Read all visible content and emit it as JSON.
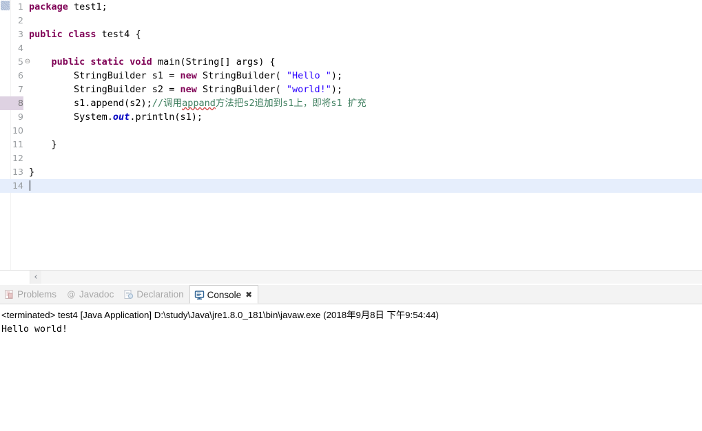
{
  "editor": {
    "annotation_ruler_marker": "changed-lines-marker",
    "current_line": 14,
    "marked_line": 8,
    "fold_line": 5,
    "fold_glyph": "⊖",
    "caret_glyph": "",
    "lines": [
      {
        "number": "1",
        "tokens": [
          {
            "t": "kw",
            "v": "package"
          },
          {
            "t": "plain",
            "v": " test1;"
          }
        ]
      },
      {
        "number": "2",
        "tokens": []
      },
      {
        "number": "3",
        "tokens": [
          {
            "t": "kw",
            "v": "public class"
          },
          {
            "t": "plain",
            "v": " test4 {"
          }
        ]
      },
      {
        "number": "4",
        "tokens": []
      },
      {
        "number": "5",
        "tokens": [
          {
            "t": "plain",
            "v": "    "
          },
          {
            "t": "kw",
            "v": "public static void"
          },
          {
            "t": "plain",
            "v": " main(String[] args) {"
          }
        ]
      },
      {
        "number": "6",
        "tokens": [
          {
            "t": "plain",
            "v": "        StringBuilder s1 = "
          },
          {
            "t": "kw",
            "v": "new"
          },
          {
            "t": "plain",
            "v": " StringBuilder( "
          },
          {
            "t": "str",
            "v": "\"Hello \""
          },
          {
            "t": "plain",
            "v": ");"
          }
        ]
      },
      {
        "number": "7",
        "tokens": [
          {
            "t": "plain",
            "v": "        StringBuilder s2 = "
          },
          {
            "t": "kw",
            "v": "new"
          },
          {
            "t": "plain",
            "v": " StringBuilder( "
          },
          {
            "t": "str",
            "v": "\"world!\""
          },
          {
            "t": "plain",
            "v": ");"
          }
        ]
      },
      {
        "number": "8",
        "tokens": [
          {
            "t": "plain",
            "v": "        s1.append(s2);"
          },
          {
            "t": "cmt",
            "v": "//调用"
          },
          {
            "t": "cmt-misspell",
            "v": "appand"
          },
          {
            "t": "cmt",
            "v": "方法把s2追加到s1上，即将s1 扩充"
          }
        ]
      },
      {
        "number": "9",
        "tokens": [
          {
            "t": "plain",
            "v": "        System."
          },
          {
            "t": "fld",
            "v": "out"
          },
          {
            "t": "plain",
            "v": ".println(s1);"
          }
        ]
      },
      {
        "number": "10",
        "tokens": []
      },
      {
        "number": "11",
        "tokens": [
          {
            "t": "plain",
            "v": "    }"
          }
        ]
      },
      {
        "number": "12",
        "tokens": []
      },
      {
        "number": "13",
        "tokens": [
          {
            "t": "plain",
            "v": "}"
          }
        ]
      },
      {
        "number": "14",
        "tokens": [],
        "caret": true
      }
    ],
    "scrollbar": {
      "left_arrow_glyph": "‹"
    }
  },
  "bottom_panel": {
    "tabs": [
      {
        "label": "Problems",
        "icon": "problems-icon",
        "active": false,
        "closable": false
      },
      {
        "label": "Javadoc",
        "icon": "javadoc-at-icon",
        "active": false,
        "closable": false
      },
      {
        "label": "Declaration",
        "icon": "declaration-icon",
        "active": false,
        "closable": false
      },
      {
        "label": "Console",
        "icon": "console-monitor-icon",
        "active": true,
        "closable": true,
        "close_glyph": "✖"
      }
    ],
    "console": {
      "header": "<terminated> test4 [Java Application] D:\\study\\Java\\jre1.8.0_181\\bin\\javaw.exe (2018年9月8日 下午9:54:44)",
      "output": "Hello world!"
    }
  },
  "colors": {
    "keyword": "#7f0055",
    "string": "#2a00ff",
    "comment": "#3f7f5f",
    "field": "#0000c0",
    "current_line_highlight": "#e6eefc",
    "marked_gutter": "#ded2e2",
    "spellcheck_squiggle": "#d44a4a"
  }
}
